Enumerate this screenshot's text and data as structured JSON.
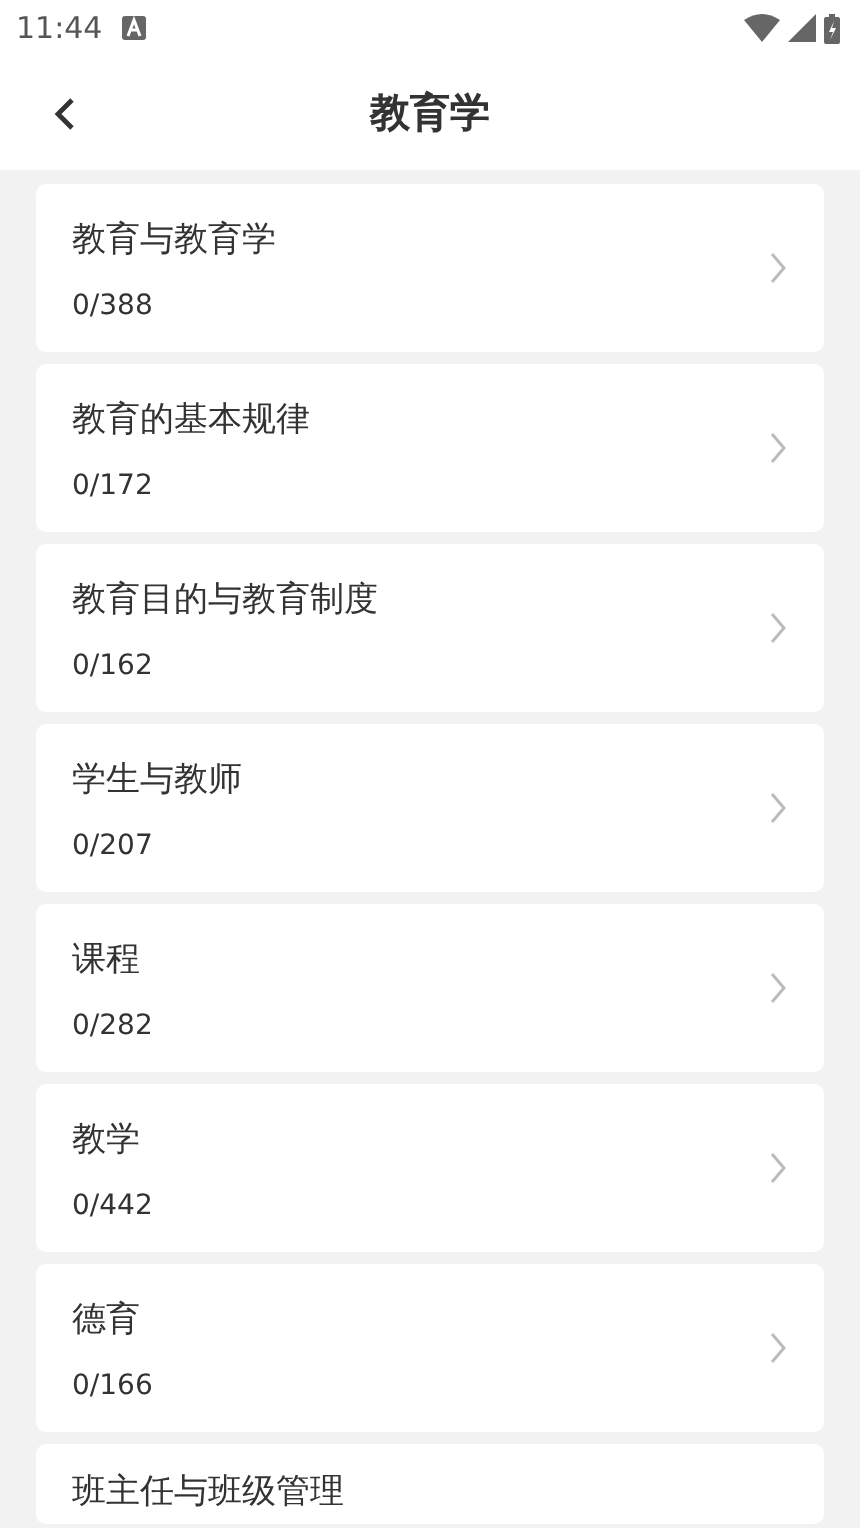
{
  "status_bar": {
    "time": "11:44"
  },
  "header": {
    "title": "教育学"
  },
  "chapters": [
    {
      "title": "教育与教育学",
      "progress": "0/388"
    },
    {
      "title": "教育的基本规律",
      "progress": "0/172"
    },
    {
      "title": "教育目的与教育制度",
      "progress": "0/162"
    },
    {
      "title": "学生与教师",
      "progress": "0/207"
    },
    {
      "title": "课程",
      "progress": "0/282"
    },
    {
      "title": "教学",
      "progress": "0/442"
    },
    {
      "title": "德育",
      "progress": "0/166"
    },
    {
      "title": "班主任与班级管理"
    }
  ]
}
